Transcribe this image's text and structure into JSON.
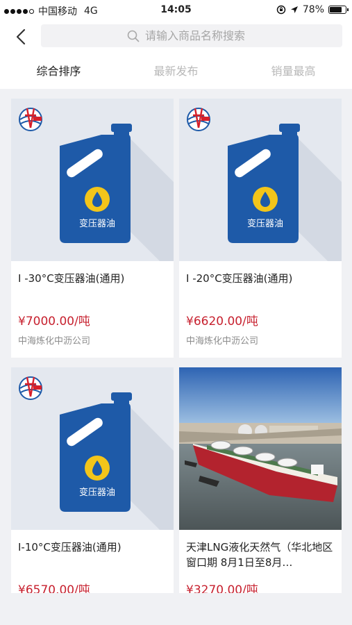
{
  "status_bar": {
    "carrier": "中国移动",
    "network": "4G",
    "time": "14:05",
    "battery": "78%",
    "battery_level": 0.78
  },
  "search": {
    "placeholder": "请输入商品名称搜索"
  },
  "tabs": [
    {
      "label": "综合排序",
      "active": true
    },
    {
      "label": "最新发布",
      "active": false
    },
    {
      "label": "销量最高",
      "active": false
    }
  ],
  "products": [
    {
      "title": "I -30°C变压器油(通用)",
      "price": "¥7000.00/吨",
      "company": "中海炼化中沥公司",
      "image": "oil-can",
      "badge": "变压器油"
    },
    {
      "title": "I -20°C变压器油(通用)",
      "price": "¥6620.00/吨",
      "company": "中海炼化中沥公司",
      "image": "oil-can",
      "badge": "变压器油"
    },
    {
      "title": "I-10°C变压器油(通用)",
      "price": "¥6570.00/吨",
      "company": "",
      "image": "oil-can",
      "badge": "变压器油"
    },
    {
      "title": "天津LNG液化天然气（华北地区 窗口期 8月1日至8月…",
      "price": "¥3270.00/吨",
      "company": "",
      "image": "lng-ship-photo",
      "badge": ""
    }
  ],
  "colors": {
    "price": "#c7212f",
    "can_blue": "#1e5aa8",
    "drop_yellow": "#f3c51a"
  },
  "icons": [
    "back-arrow-icon",
    "search-icon",
    "cnooc-logo",
    "location-arrow-icon",
    "orientation-lock-icon"
  ]
}
